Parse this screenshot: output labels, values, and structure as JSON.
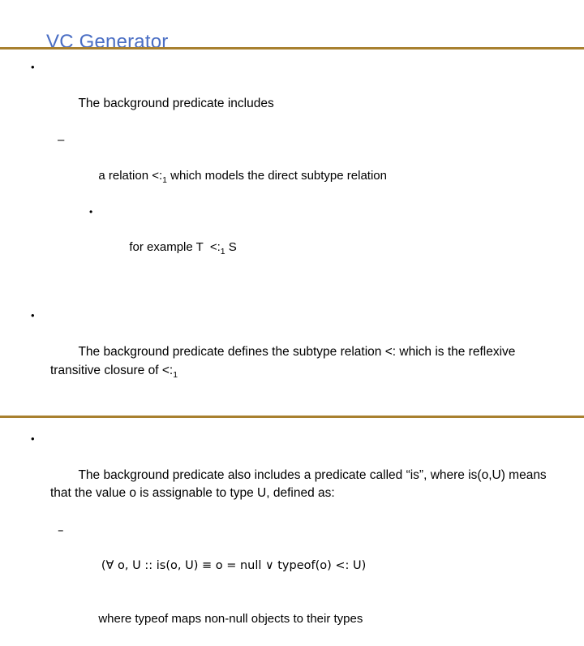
{
  "slide": {
    "title": "VC Generator",
    "title_color": "#4a6ec4",
    "rule_color": "#a8802f",
    "background_color": "#ffffff",
    "text_color": "#000000"
  },
  "markers": {
    "level1": "•",
    "level2": "–",
    "level3": "•"
  },
  "content": {
    "group1": {
      "bullet": "The background predicate includes",
      "sub1_pre": "a relation <:",
      "sub1_subscript": "1",
      "sub1_post": " which models the direct subtype relation",
      "sub2_pre": "for example T  <:",
      "sub2_subscript": "1",
      "sub2_post": " S"
    },
    "group2": {
      "bullet_pre": "The background predicate defines the subtype relation <: which is the reflexive transitive closure of <:",
      "bullet_subscript": "1"
    },
    "group3": {
      "bullet": "The background predicate also includes a predicate called “is”, where is(o,U) means that the value o is assignable to type U, defined as:",
      "formula": "(∀ o, U :: is(o, U) ≡ o = null ∨ typeof(o) <: U)",
      "closing": "where typeof maps non-null objects to their types"
    }
  }
}
